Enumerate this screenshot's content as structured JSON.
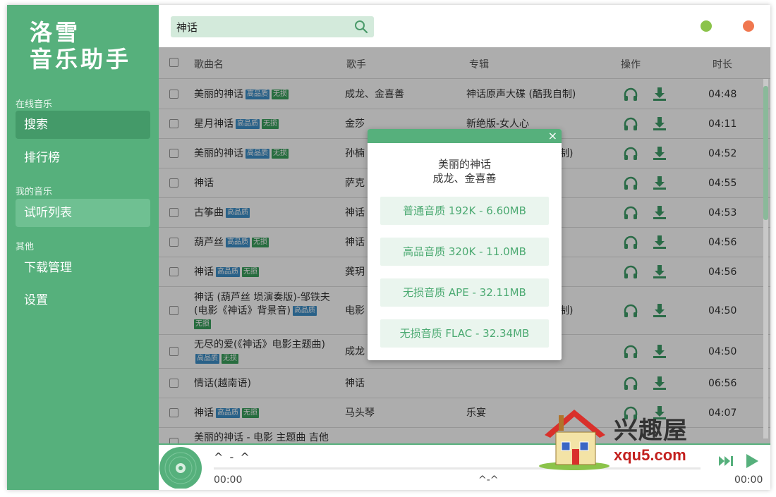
{
  "sidebar": {
    "logo_line1": "洛雪",
    "logo_line2": "音乐助手",
    "groups": [
      {
        "title": "在线音乐"
      },
      {
        "title": "我的音乐"
      },
      {
        "title": "其他"
      }
    ],
    "items": [
      {
        "label": "搜索"
      },
      {
        "label": "排行榜"
      },
      {
        "label": "试听列表"
      },
      {
        "label": "下载管理"
      },
      {
        "label": "设置"
      }
    ]
  },
  "search": {
    "value": "神话",
    "icon": "search-icon"
  },
  "table": {
    "headers": {
      "name": "歌曲名",
      "artist": "歌手",
      "album": "专辑",
      "ops": "操作",
      "duration": "时长"
    },
    "tag_hq": "高品质",
    "tag_lossless": "无损",
    "rows": [
      {
        "name": "美丽的神话",
        "artist": "成龙、金喜善",
        "album": "神话原声大碟 (酷我自制)",
        "duration": "04:48"
      },
      {
        "name": "星月神话",
        "artist": "金莎",
        "album": "新绝版-女人心",
        "duration": "04:11"
      },
      {
        "name": "美丽的神话",
        "artist": "孙楠",
        "album": "制)",
        "duration": "04:52"
      },
      {
        "name": "神话",
        "artist": "萨克",
        "album": "",
        "duration": "04:55"
      },
      {
        "name": "古筝曲",
        "artist": "神话",
        "album": "",
        "duration": "04:53"
      },
      {
        "name": "葫芦丝",
        "artist": "神话",
        "album": "",
        "duration": "04:56"
      },
      {
        "name": "神话",
        "artist": "龚玥",
        "album": "",
        "duration": "04:56"
      },
      {
        "name_line1": "神话 (葫芦丝 埙演奏版)-邹铁夫",
        "name_line2": "(电影《神话》背景音)",
        "artist": "电影",
        "album": "制)",
        "duration": "04:50"
      },
      {
        "name": "无尽的爱(《神话》电影主题曲)",
        "artist": "成龙",
        "album": "",
        "duration": "04:50"
      },
      {
        "name": "情话(越南语)",
        "artist": "神话",
        "album": "",
        "duration": "06:56"
      },
      {
        "name": "神话",
        "artist": "马头琴",
        "album": "乐宴",
        "duration": "04:07"
      },
      {
        "name": "美丽的神话 - 电影 主题曲 吉他",
        "artist": "",
        "album": "",
        "duration": ""
      }
    ]
  },
  "modal": {
    "title": "美丽的神话",
    "subtitle": "成龙、金喜善",
    "close": "×",
    "options": [
      {
        "label": "普通音质 192K - 6.60MB"
      },
      {
        "label": "高品音质 320K - 11.0MB"
      },
      {
        "label": "无损音质 APE - 32.11MB"
      },
      {
        "label": "无损音质 FLAC - 32.34MB"
      }
    ]
  },
  "player": {
    "title": "^ - ^",
    "current_time": "00:00",
    "center_text": "^-^",
    "total_time": "00:00",
    "progress": 0
  },
  "watermark": {
    "text1": "兴趣屋",
    "text2": "xqu5.com"
  },
  "colors": {
    "primary": "#56b07c",
    "hq_tag": "#3d8fc9",
    "lossless_tag": "#3aa15e",
    "window_min": "#8bc34a",
    "window_close": "#f0774f"
  }
}
